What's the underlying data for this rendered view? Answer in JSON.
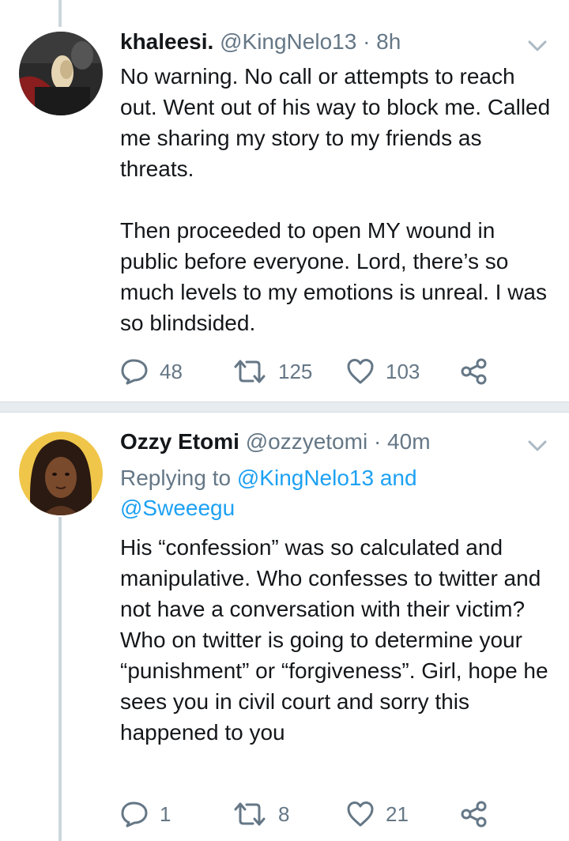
{
  "tweets": [
    {
      "name": "khaleesi.",
      "handle": "@KingNelo13",
      "time": "· 8h",
      "paragraphs": [
        "No warning. No call or attempts to reach out. Went out of his way to block me. Called me sharing my story to my friends as threats.",
        "Then proceeded to open MY wound in public before everyone. Lord, there’s so much levels to my emotions is unreal. I was so blindsided."
      ],
      "replies": "48",
      "retweets": "125",
      "likes": "103"
    },
    {
      "name": "Ozzy Etomi",
      "handle": "@ozzyetomi",
      "time": "· 40m",
      "replying_prefix": "Replying to ",
      "replying_user1": "@KingNelo13",
      "replying_and": " and",
      "replying_user2": "@Sweeegu",
      "paragraphs": [
        "His “confession” was so calculated and manipulative. Who confesses to twitter and not have a conversation with their victim?  Who on twitter is going to determine your “punishment” or “forgiveness”. Girl, hope he sees you in civil court and sorry this happened to you"
      ],
      "replies": "1",
      "retweets": "8",
      "likes": "21"
    }
  ],
  "icons": {
    "reply": "reply-icon",
    "retweet": "retweet-icon",
    "like": "heart-icon",
    "share": "share-icon",
    "caret": "chevron-down-icon"
  },
  "colors": {
    "text": "#14171a",
    "secondary": "#657786",
    "link": "#1da1f2",
    "separator": "#e6ecf0",
    "thread_line": "#ccd6dd"
  }
}
